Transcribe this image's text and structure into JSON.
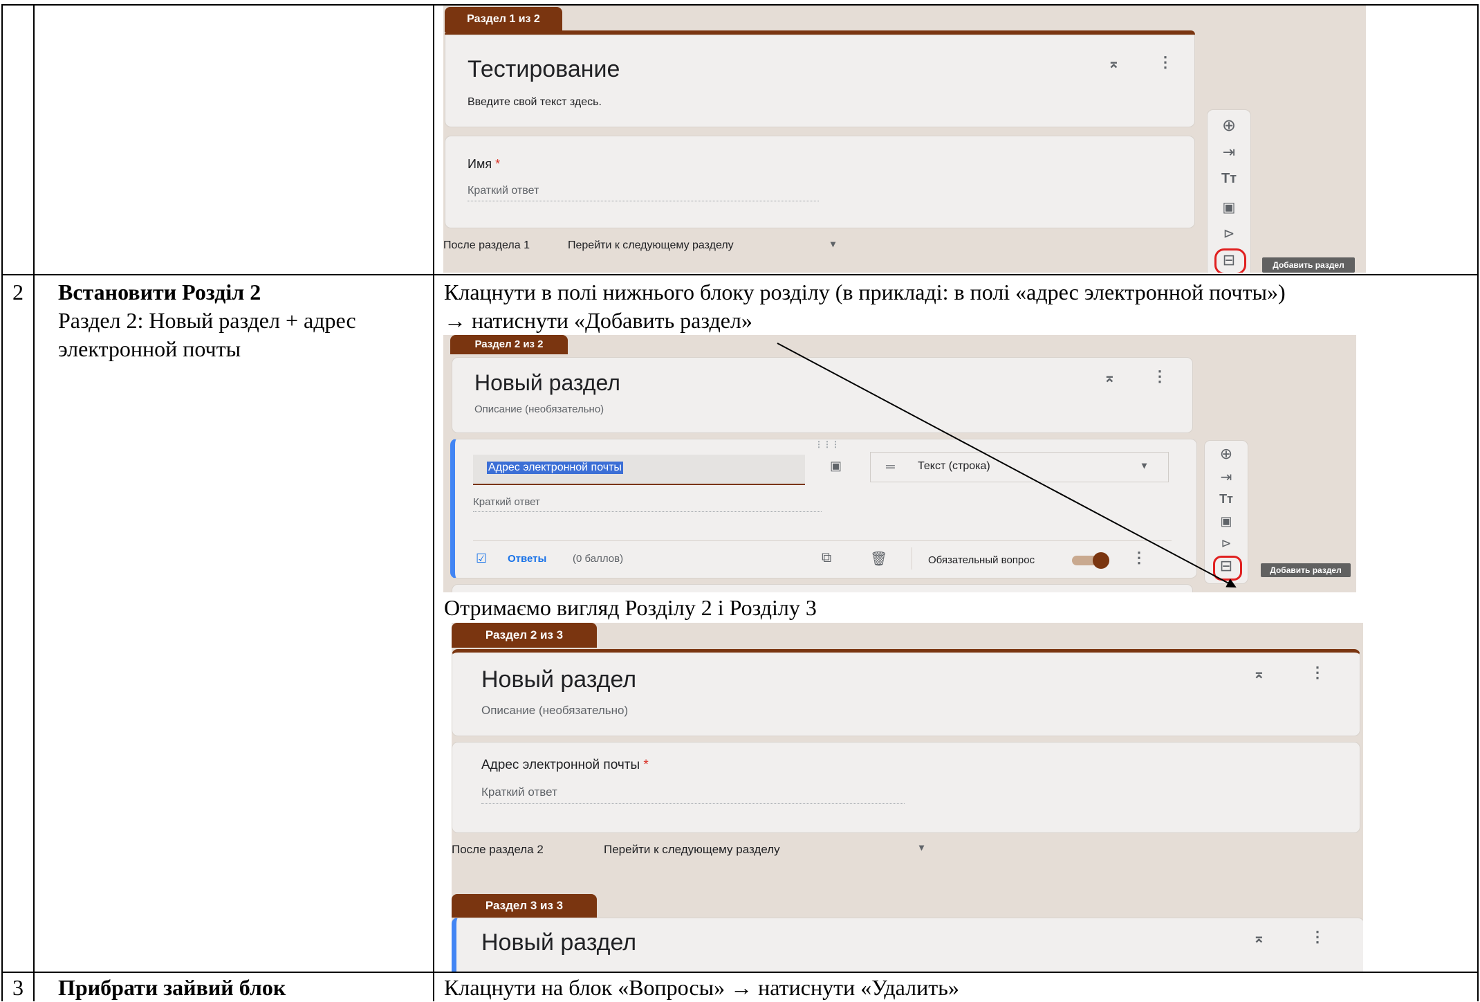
{
  "rows": [
    {
      "num": "2",
      "title": "Встановити Розділ 2",
      "desc_line1": "Раздел 2: Новый раздел + адрес",
      "desc_line2": "электронной почты",
      "instr_line1": "Клацнути  в полі нижнього блоку розділу (в прикладі: в полі «адрес электронной почты»)",
      "instr_line2": "→ натиснути «Добавить раздел»",
      "result_text": "Отримаємо вигляд Розділу 2 і Розділу 3"
    },
    {
      "num": "3",
      "title": "Прибрати зайвий блок",
      "instr": "Клацнути на блок «Вопросы» → натиснути «Удалить»"
    }
  ],
  "shot1": {
    "tab": "Раздел 1 из 2",
    "title": "Тестирование",
    "description": "Введите свой текст здесь.",
    "question": "Имя",
    "required_mark": "*",
    "answer_placeholder": "Краткий ответ",
    "after_label": "После раздела 1",
    "after_value": "Перейти к следующему разделу",
    "tooltip": "Добавить раздел"
  },
  "shot2": {
    "tab": "Раздел 2 из 2",
    "title": "Новый раздел",
    "description": "Описание (необязательно)",
    "question_value": "Адрес электронной почты",
    "type_label": "Текст (строка)",
    "answer_placeholder": "Краткий ответ",
    "answers_link": "Ответы",
    "points": "(0 баллов)",
    "required_label": "Обязательный вопрос",
    "tooltip": "Добавить раздел"
  },
  "shot3": {
    "tab_a": "Раздел 2 из 3",
    "title_a": "Новый раздел",
    "description_a": "Описание (необязательно)",
    "question": "Адрес электронной почты",
    "required_mark": "*",
    "answer_placeholder": "Краткий ответ",
    "after_label": "После раздела 2",
    "after_value": "Перейти к следующему разделу",
    "tab_b": "Раздел 3 из 3",
    "title_b": "Новый раздел"
  },
  "colors": {
    "accent": "#7a3510",
    "blue": "#4285f4",
    "red": "#d93025",
    "form_bg": "#e5ddd6"
  },
  "icons": [
    "collapse-icon",
    "more-vert-icon",
    "add-question-icon",
    "import-icon",
    "title-icon",
    "image-icon",
    "video-icon",
    "add-section-icon",
    "dropdown-icon",
    "short-text-icon",
    "answer-key-icon",
    "copy-icon",
    "delete-icon",
    "drag-handle-icon"
  ]
}
